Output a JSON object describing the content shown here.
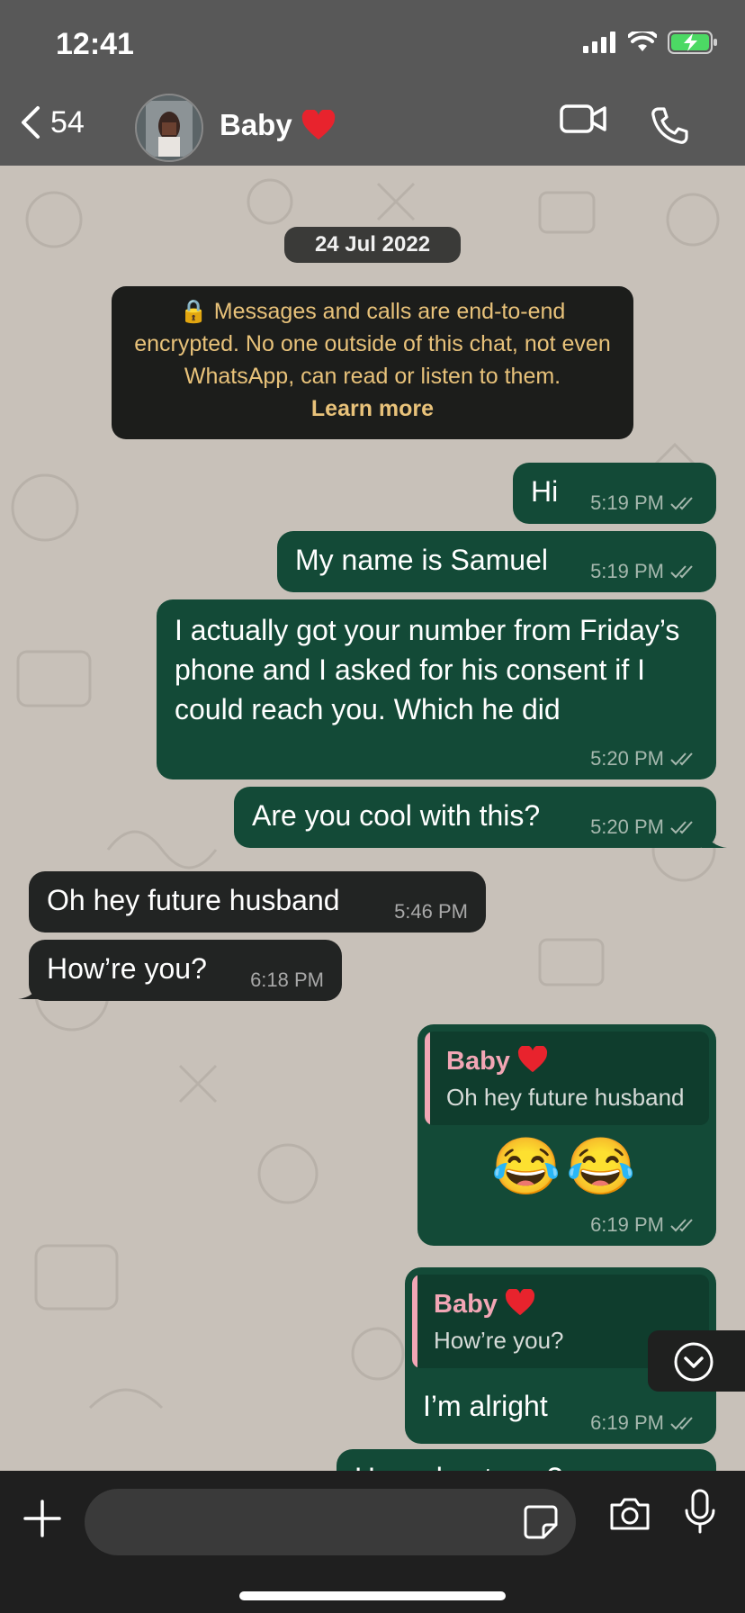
{
  "status": {
    "time": "12:41"
  },
  "header": {
    "back_count": "54",
    "contact_name": "Baby",
    "contact_emoji": "❤️"
  },
  "chat": {
    "date": "24 Jul 2022",
    "encryption_notice": "🔒 Messages and calls are end-to-end encrypted. No one outside of this chat, not even WhatsApp, can read or listen to them.",
    "learn_more": "Learn more",
    "messages": [
      {
        "dir": "out",
        "text": "Hi",
        "time": "5:19 PM"
      },
      {
        "dir": "out",
        "text": "My name is Samuel",
        "time": "5:19 PM"
      },
      {
        "dir": "out",
        "text": "I actually got your number from Friday’s phone and I asked for his consent if I could reach you. Which he did",
        "time": "5:20 PM"
      },
      {
        "dir": "out",
        "text": "Are you cool with this?",
        "time": "5:20 PM"
      },
      {
        "dir": "in",
        "text": "Oh hey future husband",
        "time": "5:46 PM"
      },
      {
        "dir": "in",
        "text": "How’re you?",
        "time": "6:18 PM"
      },
      {
        "dir": "out",
        "quote_name": "Baby",
        "quote_emoji": "❤️",
        "quote_text": "Oh hey future husband",
        "text": "😂😂",
        "time": "6:19 PM"
      },
      {
        "dir": "out",
        "quote_name": "Baby",
        "quote_emoji": "❤️",
        "quote_text": "How’re you?",
        "text": "I’m alright",
        "time": "6:19 PM"
      },
      {
        "dir": "out",
        "text": "How about you?",
        "time": ""
      }
    ]
  },
  "colors": {
    "outgoing": "#134a37",
    "incoming": "#222423",
    "quote_accent": "#f2a6b5",
    "notice_text": "#e8c27a"
  }
}
